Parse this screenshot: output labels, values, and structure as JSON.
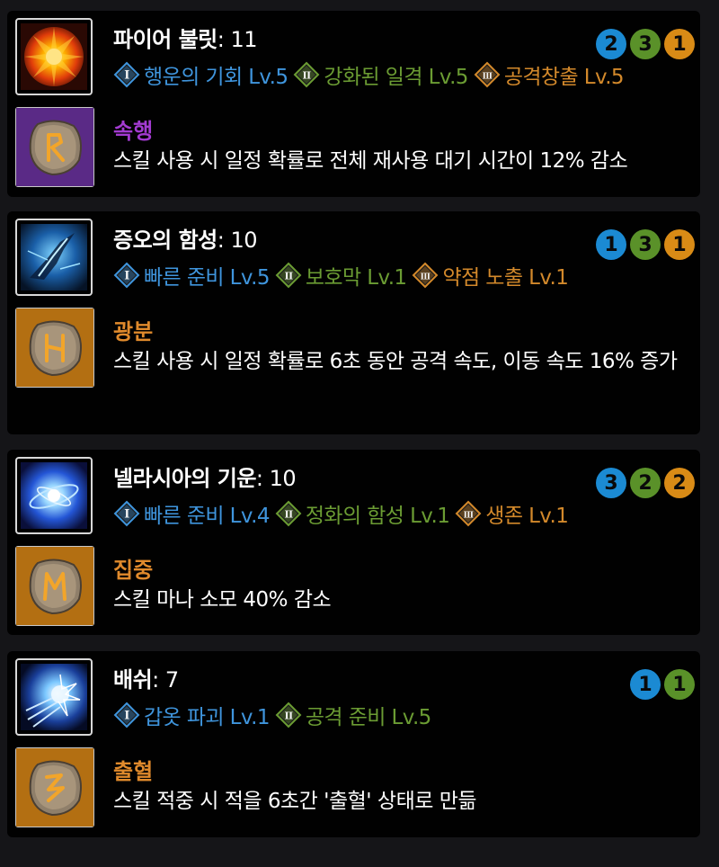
{
  "skills": [
    {
      "name": "파이어 불릿",
      "level_text": ": 11",
      "icon": "fire-bullet-skill-icon",
      "tripods": [
        {
          "tier": "I",
          "label": "행운의 기회 Lv.5"
        },
        {
          "tier": "II",
          "label": "강화된 일격 Lv.5"
        },
        {
          "tier": "III",
          "label": "공격창출 Lv.5"
        }
      ],
      "badges": [
        {
          "value": "2",
          "color": "#1b8ad3"
        },
        {
          "value": "3",
          "color": "#5a9129"
        },
        {
          "value": "1",
          "color": "#d98b16"
        }
      ],
      "rune": {
        "icon": "rune-rabbit-icon",
        "name": "속행",
        "name_color": "#a33bd1",
        "bg_color": "#5a2a86",
        "description": "스킬 사용 시 일정 확률로 전체 재사용 대기 시간이 12% 감소"
      }
    },
    {
      "name": "증오의 함성",
      "level_text": ": 10",
      "icon": "hateful-shout-skill-icon",
      "tripods": [
        {
          "tier": "I",
          "label": "빠른 준비 Lv.5"
        },
        {
          "tier": "II",
          "label": "보호막 Lv.1"
        },
        {
          "tier": "III",
          "label": "약점 노출 Lv.1"
        }
      ],
      "badges": [
        {
          "value": "1",
          "color": "#1b8ad3"
        },
        {
          "value": "3",
          "color": "#5a9129"
        },
        {
          "value": "1",
          "color": "#d98b16"
        }
      ],
      "rune": {
        "icon": "rune-h-icon",
        "name": "광분",
        "name_color": "#e08a2c",
        "bg_color": "#b36f12",
        "description": "스킬 사용 시 일정 확률로 6초 동안 공격 속도, 이동 속도 16% 증가"
      }
    },
    {
      "name": "넬라시아의 기운",
      "level_text": ": 10",
      "icon": "nelasia-energy-skill-icon",
      "tripods": [
        {
          "tier": "I",
          "label": "빠른 준비 Lv.4"
        },
        {
          "tier": "II",
          "label": "정화의 함성 Lv.1"
        },
        {
          "tier": "III",
          "label": "생존 Lv.1"
        }
      ],
      "badges": [
        {
          "value": "3",
          "color": "#1b8ad3"
        },
        {
          "value": "2",
          "color": "#5a9129"
        },
        {
          "value": "2",
          "color": "#d98b16"
        }
      ],
      "rune": {
        "icon": "rune-m-icon",
        "name": "집중",
        "name_color": "#e08a2c",
        "bg_color": "#b36f12",
        "description": "스킬 마나 소모 40% 감소"
      }
    },
    {
      "name": "배쉬",
      "level_text": ": 7",
      "icon": "bash-skill-icon",
      "tripods": [
        {
          "tier": "I",
          "label": "갑옷 파괴 Lv.1"
        },
        {
          "tier": "II",
          "label": "공격 준비 Lv.5"
        }
      ],
      "badges": [
        {
          "value": "1",
          "color": "#1b8ad3"
        },
        {
          "value": "1",
          "color": "#5a9129"
        }
      ],
      "rune": {
        "icon": "rune-bleed-icon",
        "name": "출혈",
        "name_color": "#e08a2c",
        "bg_color": "#b36f12",
        "description": "스킬 적중 시 적을 6초간 '출혈' 상태로 만듦"
      }
    }
  ],
  "colors": {
    "tier_1": "#3f95dd",
    "tier_2": "#6b9c33",
    "tier_3": "#d3892b",
    "card_bg": "#010101",
    "page_bg": "#151518"
  }
}
